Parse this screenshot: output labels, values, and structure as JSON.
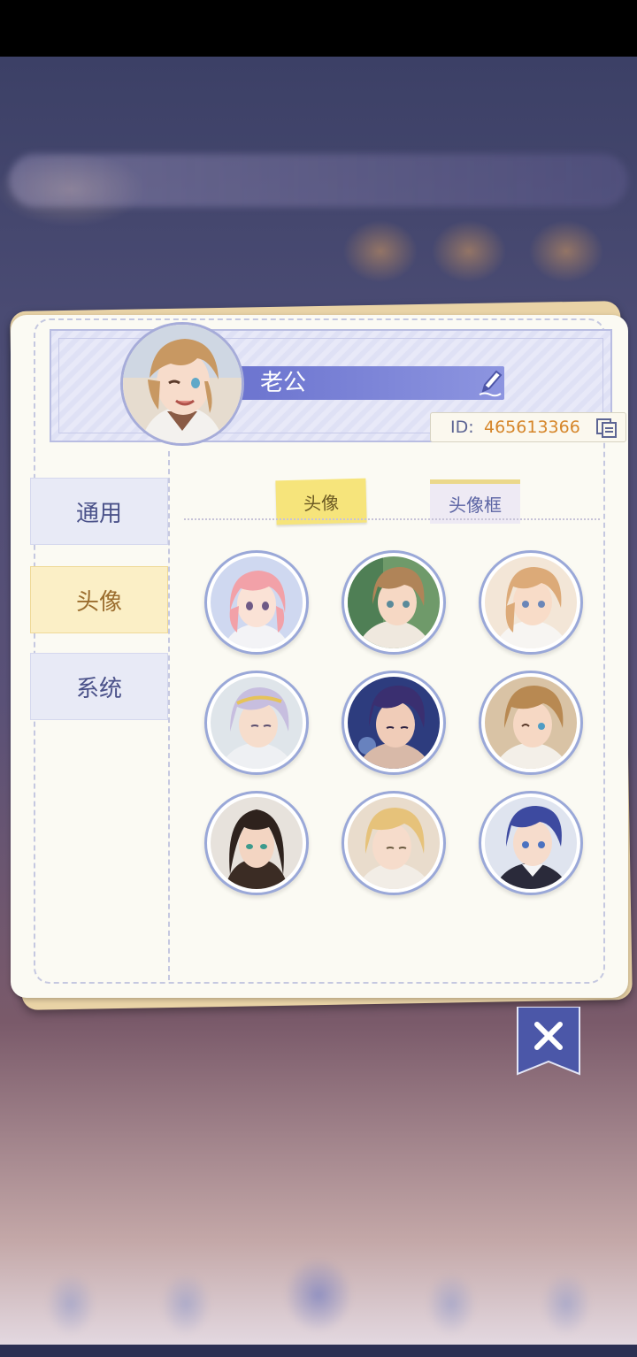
{
  "profile": {
    "nickname": "老公",
    "id_label": "ID:",
    "id_value": "465613366"
  },
  "sidebar": {
    "items": [
      {
        "label": "通用",
        "active": false
      },
      {
        "label": "头像",
        "active": true
      },
      {
        "label": "系统",
        "active": false
      }
    ]
  },
  "tabs": [
    {
      "label": "头像",
      "active": true
    },
    {
      "label": "头像框",
      "active": false
    }
  ],
  "avatars": [
    {
      "name": "pink-hair-girl"
    },
    {
      "name": "brown-hair-boy-forest"
    },
    {
      "name": "light-brown-hair-boy"
    },
    {
      "name": "silver-hair-boy"
    },
    {
      "name": "dark-blue-hair-boy"
    },
    {
      "name": "winking-blond-boy"
    },
    {
      "name": "long-black-hair-man"
    },
    {
      "name": "blond-curly-hair-boy"
    },
    {
      "name": "blue-hair-boy"
    }
  ],
  "colors": {
    "accent": "#6c74cf",
    "id_value": "#d6862a",
    "active_tab": "#f6e47b",
    "active_side": "#fbefc6"
  },
  "icons": [
    "pencil-icon",
    "copy-icon",
    "close-icon"
  ]
}
